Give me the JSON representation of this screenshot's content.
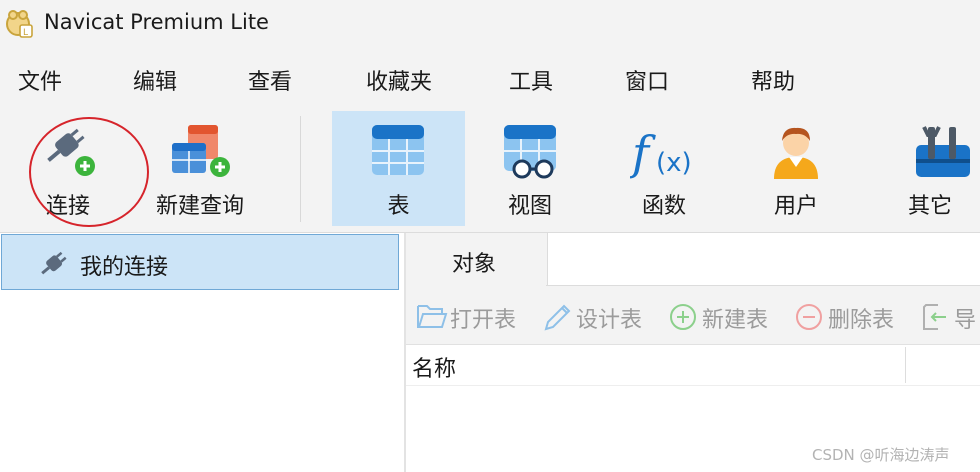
{
  "window": {
    "title": "Navicat Premium Lite"
  },
  "menu": [
    "文件",
    "编辑",
    "查看",
    "收藏夹",
    "工具",
    "窗口",
    "帮助"
  ],
  "toolbar": {
    "connect_label": "连接",
    "new_query_label": "新建查询",
    "table_label": "表",
    "view_label": "视图",
    "function_label": "函数",
    "user_label": "用户",
    "other_label": "其它",
    "active": "表"
  },
  "sidebar": {
    "connection_label": "我的连接"
  },
  "objects": {
    "tab_label": "对象",
    "actions": [
      "打开表",
      "设计表",
      "新建表",
      "删除表",
      "导"
    ],
    "column_header": "名称"
  },
  "watermark": "CSDN @听海边涛声",
  "colors": {
    "accent": "#cce4f7",
    "annotation_circle": "#d6242b",
    "add_badge": "#3cb43c"
  }
}
